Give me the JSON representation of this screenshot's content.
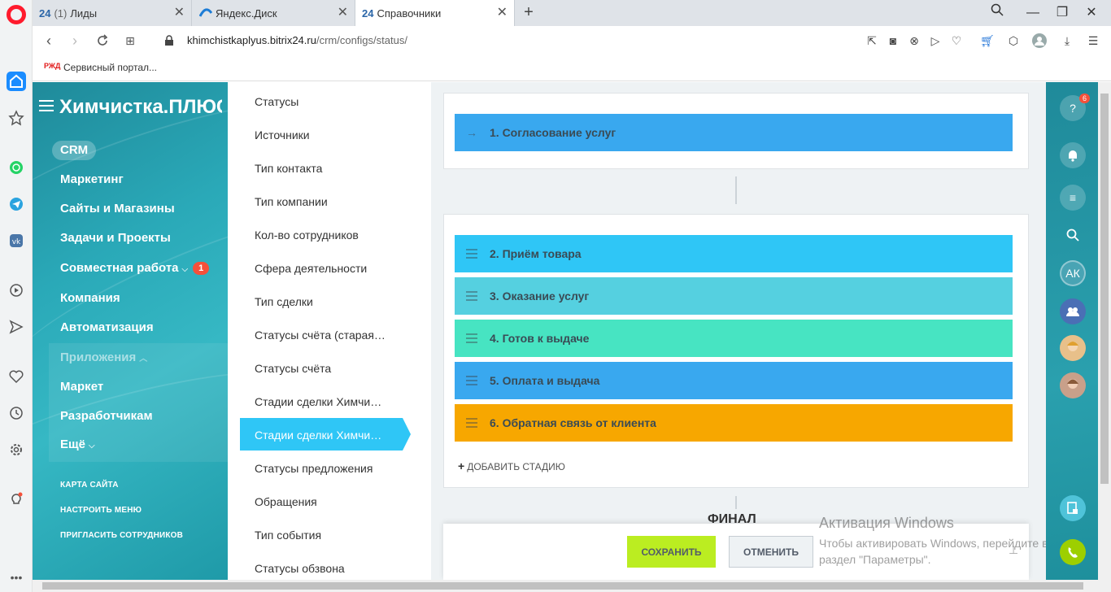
{
  "browser": {
    "tabs": [
      {
        "favicon": "24",
        "count": "(1)",
        "title": "Лиды"
      },
      {
        "favicon": "",
        "count": "",
        "title": "Яндекс.Диск"
      },
      {
        "favicon": "24",
        "count": "",
        "title": "Справочники"
      }
    ],
    "url_host": "khimchistkaplyus.bitrix24.ru",
    "url_path": "/crm/configs/status/",
    "bookmark": {
      "badge": "РЖД",
      "label": "Сервисный портал..."
    }
  },
  "left_menu": {
    "title": "Химчистка.ПЛЮС",
    "active": "CRM",
    "items": [
      {
        "label": "Маркетинг"
      },
      {
        "label": "Сайты и Магазины"
      },
      {
        "label": "Задачи и Проекты"
      },
      {
        "label": "Совместная работа",
        "counter": "1"
      },
      {
        "label": "Компания"
      },
      {
        "label": "Автоматизация"
      },
      {
        "label": "Приложения"
      },
      {
        "label": "Маркет"
      },
      {
        "label": "Разработчикам"
      },
      {
        "label": "Ещё"
      }
    ],
    "small_links": [
      "КАРТА САЙТА",
      "НАСТРОИТЬ МЕНЮ",
      "ПРИГЛАСИТЬ СОТРУДНИКОВ"
    ]
  },
  "dictionaries": [
    "Статусы",
    "Источники",
    "Тип контакта",
    "Тип компании",
    "Кол-во сотрудников",
    "Сфера деятельности",
    "Тип сделки",
    "Статусы счёта (старая…",
    "Статусы счёта",
    "Стадии сделки Химчи…",
    "Стадии сделки Химчи…",
    "Статусы предложения",
    "Обращения",
    "Тип события",
    "Статусы обзвона"
  ],
  "stages": {
    "first": {
      "label": "1. Согласование услуг",
      "color": "#39a8ef"
    },
    "list": [
      {
        "label": "2. Приём товара",
        "color": "#2fc6f6"
      },
      {
        "label": "3. Оказание услуг",
        "color": "#55d0e0"
      },
      {
        "label": "4. Готов к выдаче",
        "color": "#47e4c2"
      },
      {
        "label": "5. Оплата и выдача",
        "color": "#39a8ef"
      },
      {
        "label": "6. Обратная связь от клиента",
        "color": "#f7a700"
      }
    ],
    "add_label": "ДОБАВИТЬ СТАДИЮ",
    "final_heading": "ФИНАЛ"
  },
  "footer": {
    "save": "СОХРАНИТЬ",
    "cancel": "ОТМЕНИТЬ"
  },
  "windows_notice": {
    "title": "Активация Windows",
    "text": "Чтобы активировать Windows, перейдите в раздел \"Параметры\"."
  },
  "right_bar": {
    "help_badge": "6",
    "avatar_initials": "АК"
  }
}
